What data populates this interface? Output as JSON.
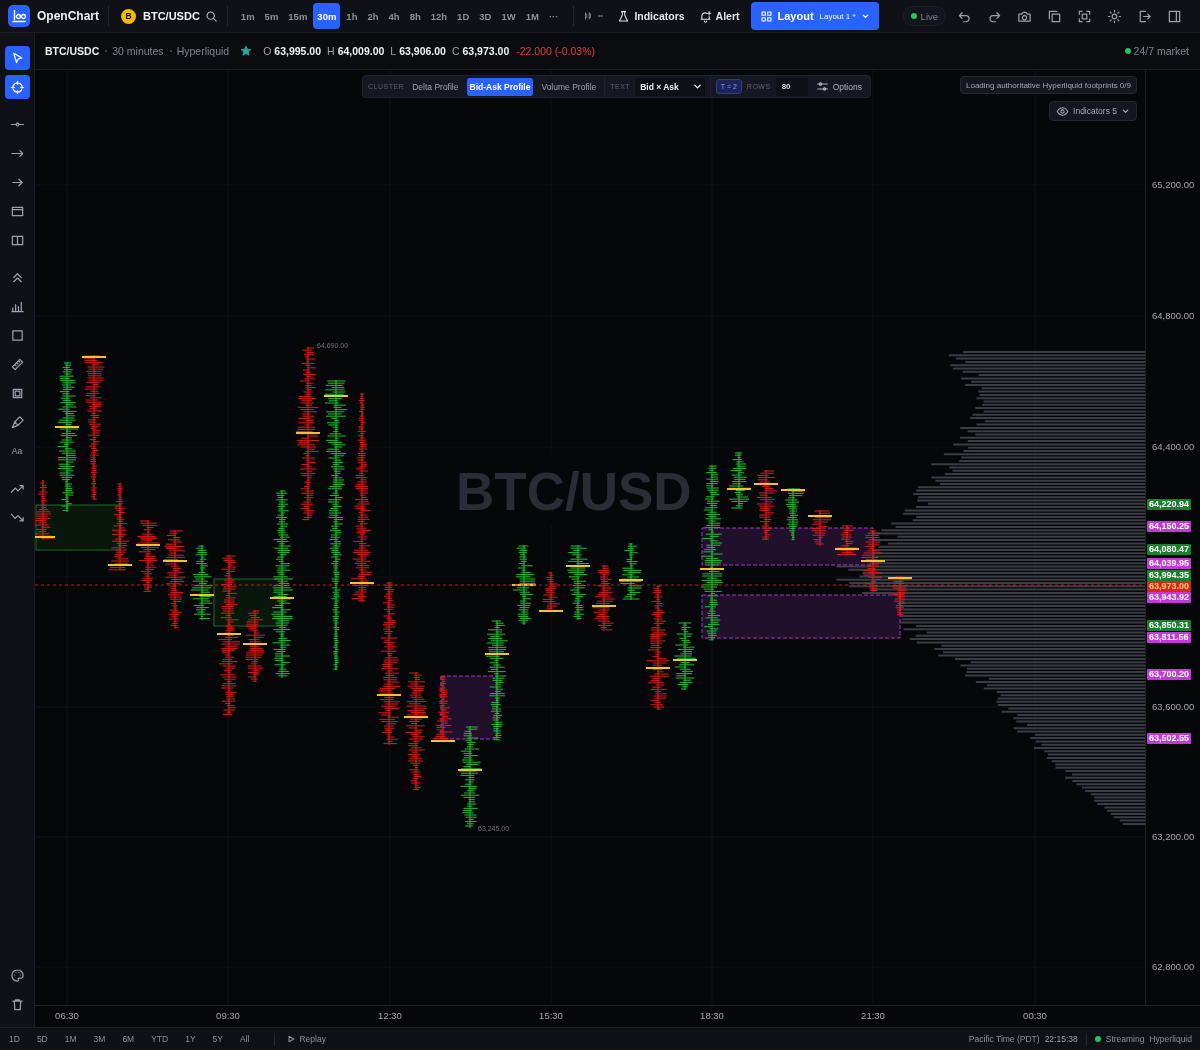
{
  "app": {
    "name": "OpenChart"
  },
  "symbol": {
    "coin_letter": "B",
    "pair": "BTC/USDC"
  },
  "timeframes": [
    {
      "label": "1m",
      "selected": false
    },
    {
      "label": "5m",
      "selected": false
    },
    {
      "label": "15m",
      "selected": false
    },
    {
      "label": "30m",
      "selected": true
    },
    {
      "label": "1h",
      "selected": false
    },
    {
      "label": "2h",
      "selected": false
    },
    {
      "label": "4h",
      "selected": false
    },
    {
      "label": "8h",
      "selected": false
    },
    {
      "label": "12h",
      "selected": false
    },
    {
      "label": "1D",
      "selected": false
    },
    {
      "label": "3D",
      "selected": false
    },
    {
      "label": "1W",
      "selected": false
    },
    {
      "label": "1M",
      "selected": false
    }
  ],
  "more_timeframes": "···",
  "toolbar": {
    "indicators": "Indicators",
    "alert": "Alert",
    "layout": {
      "label": "Layout",
      "name": "Layout 1 *"
    },
    "live": {
      "label": "Live",
      "on": true
    }
  },
  "legend": {
    "symbol": "BTC/USDC",
    "interval": "30 minutes",
    "exchange": "Hyperliquid",
    "favorite": true,
    "ohlc": [
      {
        "key": "O",
        "value": "63,995.00"
      },
      {
        "key": "H",
        "value": "64,009.00"
      },
      {
        "key": "L",
        "value": "63,906.00"
      },
      {
        "key": "C",
        "value": "63,973.00"
      }
    ],
    "change": "-22.000 (-0.03%)",
    "market": {
      "label": "24/7 market",
      "open": true
    }
  },
  "drawing_tools": [
    {
      "selected": true
    },
    {
      "selected": true
    },
    {
      "selected": false
    },
    {
      "selected": false
    },
    {
      "selected": false
    },
    {
      "selected": false
    },
    {
      "selected": false
    },
    {
      "selected": false
    },
    {
      "selected": false
    },
    {
      "selected": false
    },
    {
      "selected": false
    },
    {
      "selected": false
    },
    {
      "selected": false
    },
    {
      "selected": false,
      "glyph": "Aa"
    },
    {
      "selected": false
    },
    {
      "selected": false
    }
  ],
  "cluster_toolbar": {
    "label": "CLUSTER",
    "modes": [
      {
        "label": "Delta Profile",
        "selected": false
      },
      {
        "label": "Bid-Ask Profile",
        "selected": true
      },
      {
        "label": "Volume Profile",
        "selected": false
      }
    ],
    "text_label": "TEXT",
    "text_mode": "Bid × Ask",
    "tick_size": "T = 2",
    "rows_label": "ROWS",
    "rows": "80",
    "options": "Options"
  },
  "loading_notice": "Loading authoritative Hyperliquid footprints 0/9",
  "indicators_menu": "Indicators 5",
  "chart": {
    "watermark": "BTC/USD",
    "high_label": "64,690.00",
    "low_label": "63,245.00",
    "price_ticks": [
      "65,200.00",
      "64,800.00",
      "64,400.00",
      "63,600.00",
      "63,200.00",
      "62,800.00"
    ],
    "time_ticks": [
      "06:30",
      "09:30",
      "12:30",
      "15:30",
      "18:30",
      "21:30",
      "00:30"
    ],
    "price_markers": [
      {
        "label": "64,220.94",
        "kind": "level",
        "color": "#1b7f2e"
      },
      {
        "label": "64,150.25",
        "kind": "level",
        "color": "#c23ad6"
      },
      {
        "label": "64,080.47",
        "kind": "level",
        "color": "#1b7f2e"
      },
      {
        "label": "64,039.95",
        "kind": "level",
        "color": "#c23ad6"
      },
      {
        "label": "63,994.35",
        "kind": "level",
        "color": "#1b7f2e"
      },
      {
        "label": "63,973.00",
        "kind": "current",
        "color": "#d9261c"
      },
      {
        "label": "63,943.92",
        "kind": "level",
        "color": "#c23ad6"
      },
      {
        "label": "63,850.31",
        "kind": "level",
        "color": "#1b7f2e"
      },
      {
        "label": "63,811.56",
        "kind": "level",
        "color": "#c23ad6"
      },
      {
        "label": "63,700.20",
        "kind": "level",
        "color": "#c23ad6"
      },
      {
        "label": "63,502.55",
        "kind": "level",
        "color": "#c23ad6"
      }
    ]
  },
  "bottom_bar": {
    "ranges": [
      "1D",
      "5D",
      "1M",
      "3M",
      "6M",
      "YTD",
      "1Y",
      "5Y",
      "All"
    ],
    "replay": "Replay",
    "timezone": "Pacific Time (PDT)",
    "clock": "22:15:38",
    "stream": {
      "status": "Streaming",
      "source": "Hyperliquid",
      "on": true
    }
  }
}
